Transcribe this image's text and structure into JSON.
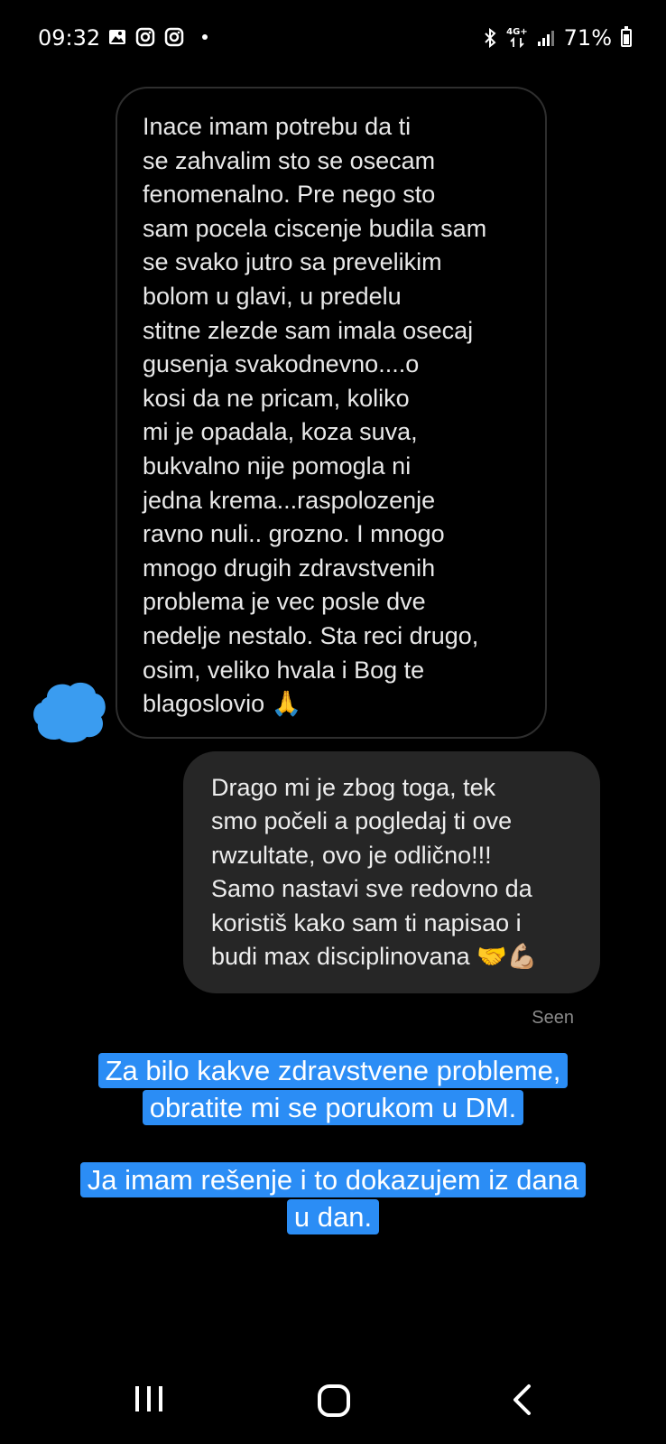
{
  "status_bar": {
    "time": "09:32",
    "network": "4G+",
    "battery": "71%",
    "notification_icons": [
      "gallery-icon",
      "instagram-icon",
      "instagram-icon",
      "dot-icon"
    ],
    "status_icons": [
      "bluetooth-icon",
      "network-arrows-icon",
      "signal-icon",
      "battery-icon"
    ]
  },
  "conversation": {
    "incoming_message": "Inace imam potrebu da ti\nse zahvalim sto se osecam\nfenomenalno. Pre nego sto\nsam pocela ciscenje budila sam\nse svako jutro sa prevelikim\nbolom u glavi, u predelu\nstitne zlezde sam imala osecaj\ngusenja svakodnevno....o\nkosi da ne pricam, koliko\nmi je opadala, koza suva,\nbukvalno nije pomogla ni\njedna krema...raspolozenje\nravno nuli.. grozno. I mnogo\nmnogo drugih zdravstvenih\nproblema je vec posle dve\nnedelje nestalo. Sta reci drugo,\nosim, veliko hvala i Bog te\nblagoslovio 🙏",
    "outgoing_message": "Drago mi je zbog toga, tek\nsmo počeli a pogledaj ti ove\nrwzultate, ovo je odlično!!!\nSamo nastavi sve redovno da\nkoristiš kako sam ti napisao i\nbudi max disciplinovana 🤝💪🏼",
    "seen_label": "Seen",
    "avatar_color": "#3a9cf0"
  },
  "captions": {
    "caption_1_line_1": "Za bilo kakve zdravstvene probleme,",
    "caption_1_line_2": "obratite mi se porukom u DM.",
    "caption_2_line_1": "Ja imam rešenje i to dokazujem iz dana",
    "caption_2_line_2": "u dan.",
    "highlight_color": "#2b8df5"
  },
  "nav_bar": {
    "icons": [
      "recents-icon",
      "home-icon",
      "back-icon"
    ]
  }
}
